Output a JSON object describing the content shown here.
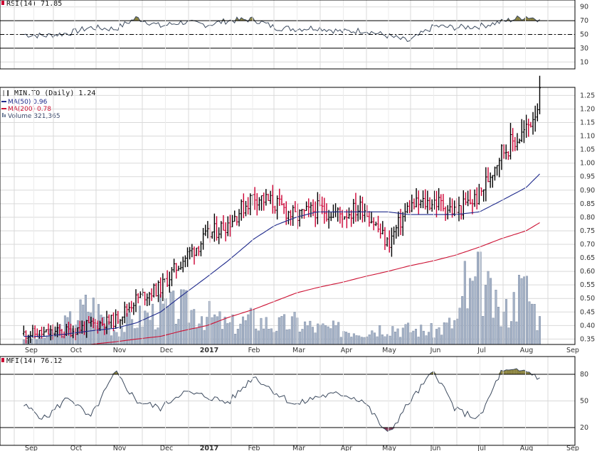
{
  "colors": {
    "background": "#ffffff",
    "grid": "#d9d9d9",
    "price_up": "#000000",
    "price_down": "#cc0033",
    "ma50": "#1f2a8c",
    "ma200": "#cc1133",
    "volume": "#a7b4c8",
    "volume_stroke": "#6f7f99",
    "osc_line": "#3c4a5e",
    "overbought_fill": "#8c8440",
    "oversold_fill": "#8a3a5a"
  },
  "chart_data": [
    {
      "type": "line",
      "panel": "rsi",
      "title": "RSI(14) 71.85",
      "ylim": [
        0,
        100
      ],
      "y_ticks": [
        "90",
        "70",
        "50",
        "30",
        "10"
      ],
      "reference_lines": [
        70,
        50,
        30
      ],
      "x": [
        "2016-09-01",
        "2016-09-15",
        "2016-10-01",
        "2016-10-15",
        "2016-11-01",
        "2016-11-15",
        "2016-12-01",
        "2016-12-15",
        "2017-01-01",
        "2017-01-15",
        "2017-02-01",
        "2017-02-15",
        "2017-03-01",
        "2017-03-15",
        "2017-04-01",
        "2017-04-15",
        "2017-05-01",
        "2017-05-15",
        "2017-06-01",
        "2017-06-15",
        "2017-07-01",
        "2017-07-15",
        "2017-08-01",
        "2017-08-10"
      ],
      "series": [
        {
          "values": [
            50,
            48,
            52,
            60,
            58,
            74,
            62,
            68,
            64,
            70,
            72,
            60,
            58,
            60,
            54,
            56,
            48,
            40,
            62,
            60,
            62,
            68,
            76,
            71.85
          ]
        }
      ]
    },
    {
      "type": "bar",
      "panel": "price",
      "title": "MIN.TO (Daily) 1.24",
      "legend": [
        "MA(50) 0.96",
        "MA(200) 0.78",
        "Volume 321,365"
      ],
      "legend_placement": "top-left",
      "ylim": [
        0.33,
        1.28
      ],
      "y_ticks": [
        "1.25",
        "1.20",
        "1.15",
        "1.10",
        "1.05",
        "1.00",
        "0.95",
        "0.90",
        "0.85",
        "0.80",
        "0.75",
        "0.70",
        "0.65",
        "0.60",
        "0.55",
        "0.50",
        "0.45",
        "0.40",
        "0.35"
      ],
      "x_ticks": [
        "Sep",
        "Oct",
        "Nov",
        "Dec",
        "2017",
        "Feb",
        "Mar",
        "Apr",
        "May",
        "Jun",
        "Jul",
        "Aug",
        "Sep"
      ],
      "x": [
        "2016-09-01",
        "2016-09-15",
        "2016-10-01",
        "2016-10-15",
        "2016-11-01",
        "2016-11-15",
        "2016-12-01",
        "2016-12-15",
        "2017-01-01",
        "2017-01-15",
        "2017-02-01",
        "2017-02-15",
        "2017-03-01",
        "2017-03-15",
        "2017-04-01",
        "2017-04-15",
        "2017-05-01",
        "2017-05-15",
        "2017-06-01",
        "2017-06-15",
        "2017-07-01",
        "2017-07-15",
        "2017-08-01",
        "2017-08-10"
      ],
      "series": [
        {
          "name": "MIN.TO",
          "values": [
            0.37,
            0.37,
            0.38,
            0.4,
            0.42,
            0.5,
            0.54,
            0.64,
            0.73,
            0.78,
            0.88,
            0.85,
            0.8,
            0.83,
            0.81,
            0.84,
            0.7,
            0.84,
            0.86,
            0.82,
            0.88,
            1.04,
            1.12,
            1.24
          ]
        },
        {
          "name": "MA(50)",
          "values": [
            0.36,
            0.36,
            0.37,
            0.38,
            0.39,
            0.41,
            0.45,
            0.51,
            0.58,
            0.64,
            0.72,
            0.77,
            0.8,
            0.82,
            0.82,
            0.82,
            0.82,
            0.81,
            0.81,
            0.81,
            0.82,
            0.86,
            0.91,
            0.96
          ]
        },
        {
          "name": "MA(200)",
          "values": [
            0.33,
            0.33,
            0.33,
            0.33,
            0.34,
            0.35,
            0.36,
            0.38,
            0.4,
            0.43,
            0.46,
            0.49,
            0.52,
            0.54,
            0.56,
            0.58,
            0.6,
            0.62,
            0.64,
            0.66,
            0.69,
            0.72,
            0.75,
            0.78
          ]
        },
        {
          "name": "Volume",
          "values": [
            0.08,
            0.1,
            0.3,
            0.55,
            0.2,
            0.35,
            0.45,
            0.5,
            0.4,
            0.25,
            0.35,
            0.25,
            0.3,
            0.22,
            0.2,
            0.18,
            0.25,
            0.2,
            0.18,
            0.3,
            0.9,
            0.35,
            0.75,
            0.32
          ]
        }
      ]
    },
    {
      "type": "line",
      "panel": "mfi",
      "title": "MFI(14) 76.12",
      "ylim": [
        0,
        100
      ],
      "y_ticks": [
        "80",
        "50",
        "20"
      ],
      "x_ticks": [
        "Sep",
        "Oct",
        "Nov",
        "Dec",
        "2017",
        "Feb",
        "Mar",
        "Apr",
        "May",
        "Jun",
        "Jul",
        "Aug",
        "Sep"
      ],
      "reference_lines": [
        80,
        20
      ],
      "x": [
        "2016-09-01",
        "2016-09-15",
        "2016-10-01",
        "2016-10-15",
        "2016-11-01",
        "2016-11-15",
        "2016-12-01",
        "2016-12-15",
        "2017-01-01",
        "2017-01-15",
        "2017-02-01",
        "2017-02-15",
        "2017-03-01",
        "2017-03-15",
        "2017-04-01",
        "2017-04-15",
        "2017-05-01",
        "2017-05-15",
        "2017-06-01",
        "2017-06-15",
        "2017-07-01",
        "2017-07-15",
        "2017-08-01",
        "2017-08-10"
      ],
      "series": [
        {
          "values": [
            45,
            30,
            55,
            30,
            82,
            50,
            42,
            60,
            55,
            48,
            78,
            60,
            45,
            55,
            58,
            50,
            12,
            48,
            84,
            40,
            30,
            82,
            84,
            76.12
          ]
        }
      ]
    }
  ]
}
